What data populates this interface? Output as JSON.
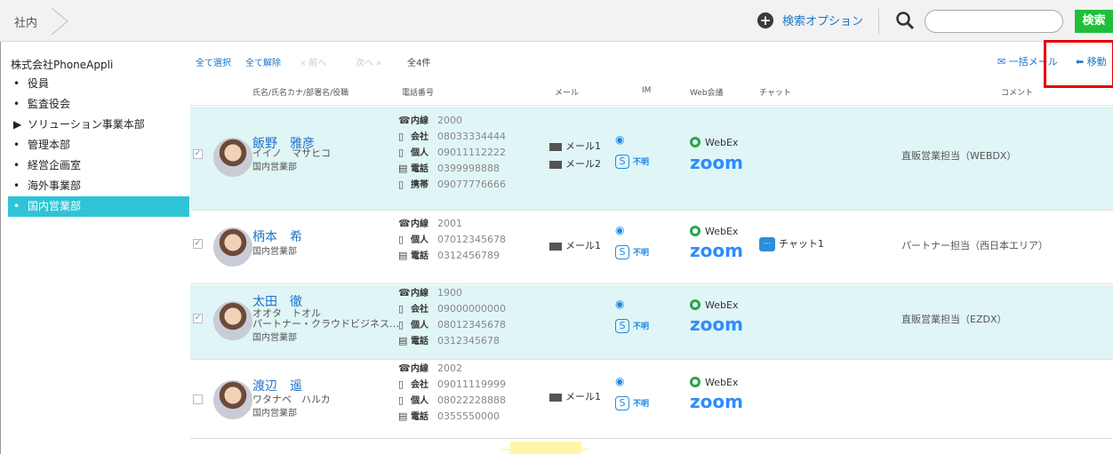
{
  "topbar": {
    "breadcrumb": "社内",
    "search_options_label": "検索オプション",
    "search_placeholder": "",
    "search_button": "検索"
  },
  "sidebar": {
    "org": "株式会社PhoneAppli",
    "items": [
      {
        "marker": "•",
        "label": "役員"
      },
      {
        "marker": "•",
        "label": "監査役会"
      },
      {
        "marker": "▶",
        "label": "ソリューション事業本部"
      },
      {
        "marker": "•",
        "label": "管理本部"
      },
      {
        "marker": "•",
        "label": "経営企画室"
      },
      {
        "marker": "•",
        "label": "海外事業部"
      },
      {
        "marker": "•",
        "label": "国内営業部"
      }
    ]
  },
  "toolbar": {
    "select_all": "全て選択",
    "deselect_all": "全て解除",
    "prev": "« 前へ",
    "next": "次へ »",
    "count": "全4件",
    "bulk_mail": "一括メール",
    "move": "移動"
  },
  "columns": {
    "name": "氏名/氏名カナ/部署名/役職",
    "phone": "電話番号",
    "mail": "メール",
    "im": "IM",
    "web": "Web会議",
    "chat": "チャット",
    "comment": "コメント"
  },
  "rows": [
    {
      "checked": "✓",
      "name": "飯野　雅彦",
      "kana": "イイノ　マサヒコ",
      "extra": "",
      "dept": "国内営業部",
      "phones": [
        {
          "icon": "☎",
          "label": "内線",
          "number": "2000"
        },
        {
          "icon": "▯",
          "label": "会社",
          "number": "08033334444"
        },
        {
          "icon": "▯",
          "label": "個人",
          "number": "09011112222"
        },
        {
          "icon": "▤",
          "label": "電話",
          "number": "0399998888"
        },
        {
          "icon": "▯",
          "label": "携帯",
          "number": "09077776666"
        }
      ],
      "mails": [
        "メール1",
        "メール2"
      ],
      "im_unknown": "不明",
      "webex": "WebEx",
      "zoom": "zoom",
      "chat": "",
      "comment": "直販営業担当（WEBDX）"
    },
    {
      "checked": "✓",
      "name": "柄本　希",
      "kana": "",
      "extra": "",
      "dept": "国内営業部",
      "phones": [
        {
          "icon": "☎",
          "label": "内線",
          "number": "2001"
        },
        {
          "icon": "▯",
          "label": "個人",
          "number": "07012345678"
        },
        {
          "icon": "▤",
          "label": "電話",
          "number": "0312456789"
        }
      ],
      "mails": [
        "メール1"
      ],
      "im_unknown": "不明",
      "webex": "WebEx",
      "zoom": "zoom",
      "chat": "チャット1",
      "comment": "パートナー担当（西日本エリア）"
    },
    {
      "checked": "✓",
      "name": "太田　徹",
      "kana": "オオタ　トオル",
      "extra": "パートナー・クラウドビジネス…",
      "dept": "国内営業部",
      "phones": [
        {
          "icon": "☎",
          "label": "内線",
          "number": "1900"
        },
        {
          "icon": "▯",
          "label": "会社",
          "number": "09000000000"
        },
        {
          "icon": "▯",
          "label": "個人",
          "number": "08012345678"
        },
        {
          "icon": "▤",
          "label": "電話",
          "number": "0312345678"
        }
      ],
      "mails": [],
      "im_unknown": "不明",
      "webex": "WebEx",
      "zoom": "zoom",
      "chat": "",
      "comment": "直販営業担当（EZDX）"
    },
    {
      "checked": "",
      "name": "渡辺　遥",
      "kana": "ワタナベ　ハルカ",
      "extra": "",
      "dept": "国内営業部",
      "phones": [
        {
          "icon": "☎",
          "label": "内線",
          "number": "2002"
        },
        {
          "icon": "▯",
          "label": "会社",
          "number": "09011119999"
        },
        {
          "icon": "▯",
          "label": "個人",
          "number": "08022228888"
        },
        {
          "icon": "▤",
          "label": "電話",
          "number": "0355550000"
        }
      ],
      "mails": [
        "メール1"
      ],
      "im_unknown": "不明",
      "webex": "WebEx",
      "zoom": "zoom",
      "chat": "",
      "comment": ""
    }
  ]
}
